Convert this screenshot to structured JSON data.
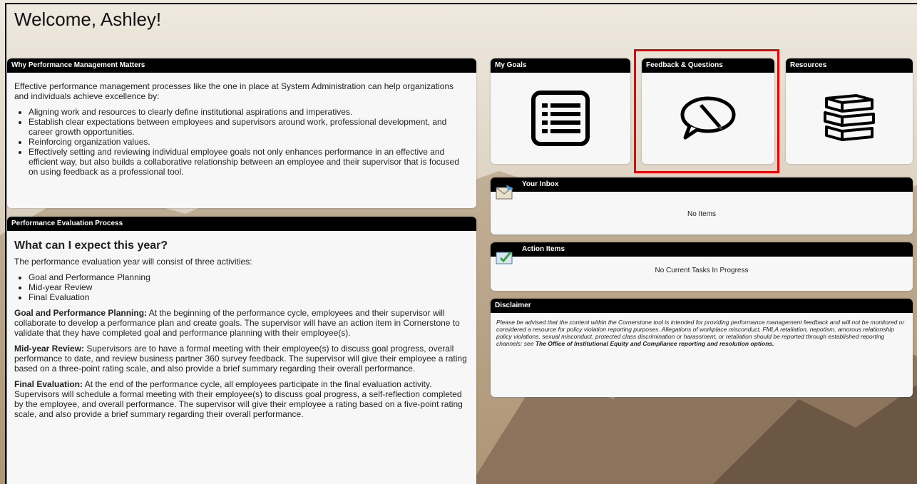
{
  "welcome": "Welcome, Ashley!",
  "why": {
    "title": "Why Performance Management Matters",
    "intro": "Effective performance management processes like the one in place at System Administration can help organizations and individuals achieve excellence by:",
    "bullets": [
      "Aligning work and resources to clearly define institutional aspirations and imperatives.",
      "Establish clear expectations between employees and supervisors around work, professional development, and career growth opportunities.",
      "Reinforcing organization values.",
      "Effectively setting and reviewing individual employee goals not only enhances performance in an effective and efficient way, but also builds a collaborative relationship between an employee and their supervisor that is focused on using feedback as a professional tool."
    ]
  },
  "process": {
    "title": "Performance Evaluation Process",
    "heading": "What can I expect this year?",
    "intro": "The performance evaluation year will consist of three activities:",
    "activities": [
      "Goal and Performance Planning",
      "Mid-year Review",
      "Final Evaluation"
    ],
    "goal_label": "Goal and Performance Planning:",
    "goal_text": " At the beginning of the performance cycle, employees and their supervisor will collaborate to develop a performance plan and create goals. The supervisor will have an action item in Cornerstone to validate that they have completed goal and performance planning with their employee(s).",
    "mid_label": "Mid-year Review:",
    "mid_text": " Supervisors are to have a formal meeting with their employee(s) to discuss goal progress, overall performance to date, and review business partner 360 survey feedback. The supervisor will give their employee a rating based on a three-point rating scale, and also provide a brief summary regarding their overall performance.",
    "final_label": "Final Evaluation:",
    "final_text": " At the end of the performance cycle, all employees participate in the final evaluation activity. Supervisors will schedule a formal meeting with their employee(s) to discuss goal progress, a self-reflection completed by the employee, and overall performance. The supervisor will give their employee a rating based on a five-point rating scale, and also provide a brief summary regarding their overall performance."
  },
  "tiles": {
    "goals": "My Goals",
    "feedback": "Feedback & Questions",
    "resources": "Resources"
  },
  "inbox": {
    "title": "Your Inbox",
    "empty": "No Items"
  },
  "actions": {
    "title": "Action Items",
    "empty": "No Current Tasks In Progress"
  },
  "disclaimer": {
    "title": "Disclaimer",
    "text": "Please be advised that the content within the Cornerstone tool is intended for providing performance management feedback and will not be monitored or considered a resource for policy violation reporting purposes. Allegations of workplace misconduct, FMLA retaliation, nepotism, amorous relationship policy violations, sexual misconduct, protected class discrimination or harassment, or retaliation should be reported through established reporting channels: see ",
    "link": "The Office of Institutional Equity and Compliance reporting and resolution options."
  },
  "colors": {
    "header": "#000000",
    "panel": "#f7f7f7",
    "highlight": "#e00000"
  }
}
